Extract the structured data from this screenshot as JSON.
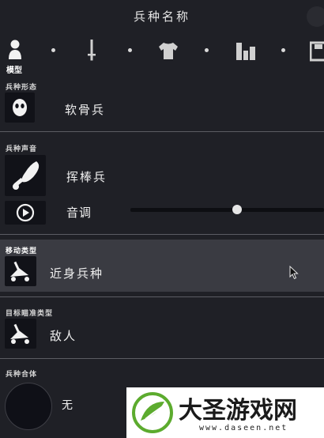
{
  "header": {
    "title": "兵种名称"
  },
  "tabs": {
    "active_label": "模型"
  },
  "sections": {
    "form": {
      "label": "兵种形态",
      "value": "软骨兵"
    },
    "sound": {
      "label": "兵种声音",
      "value": "挥棒兵",
      "pitch_label": "音调",
      "pitch_level": 0.55
    },
    "movement": {
      "label": "移动类型",
      "value": "近身兵种"
    },
    "targeting": {
      "label": "目标瞄准类型",
      "value": "敌人"
    },
    "merge": {
      "label": "兵种合体",
      "value": "无"
    }
  },
  "watermark": {
    "brand": "大圣游戏网",
    "url": "www.daseen.net"
  },
  "colors": {
    "background": "#1f2026",
    "highlight": "#3a3b42",
    "icon_box": "#111218",
    "watermark_green": "#5cab2e"
  },
  "icons": [
    "person-icon",
    "sword-icon",
    "shirt-icon",
    "bars-icon",
    "save-icon",
    "mask-icon",
    "club-icon",
    "play-icon",
    "weapon-cart-icon",
    "logo-icon"
  ]
}
